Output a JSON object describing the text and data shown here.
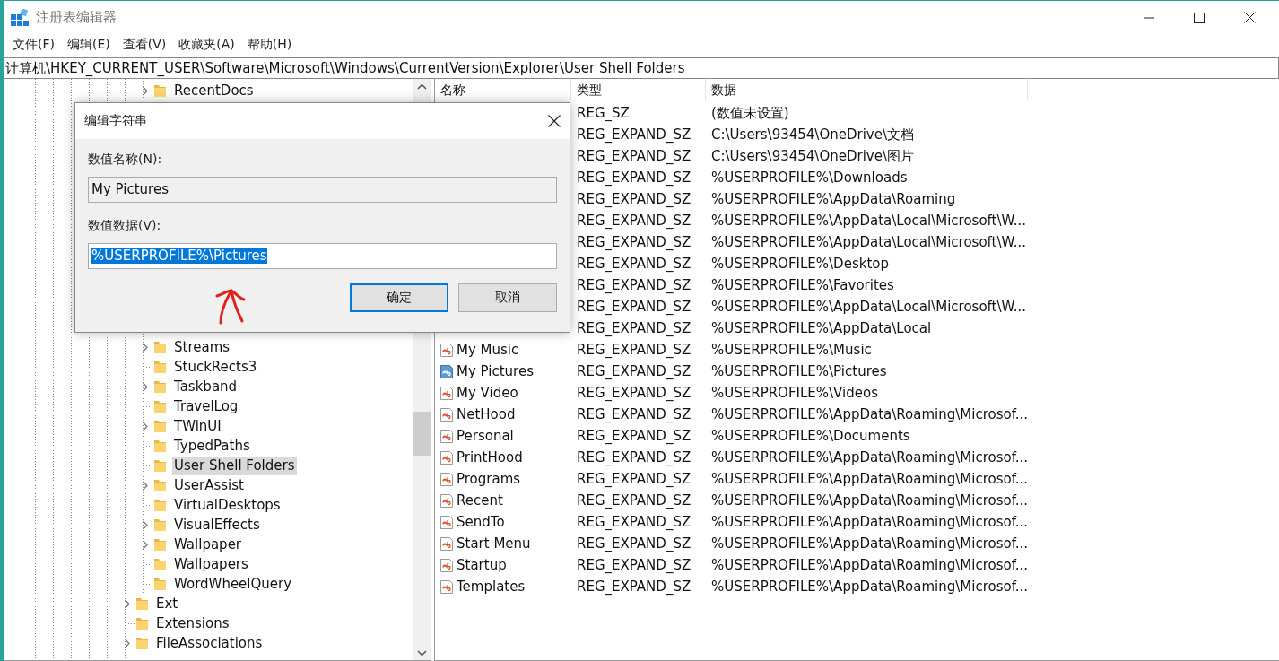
{
  "window": {
    "title": "注册表编辑器"
  },
  "menu": [
    "文件(F)",
    "编辑(E)",
    "查看(V)",
    "收藏夹(A)",
    "帮助(H)"
  ],
  "address": "计算机\\HKEY_CURRENT_USER\\Software\\Microsoft\\Windows\\CurrentVersion\\Explorer\\User Shell Folders",
  "tree": [
    {
      "children": [
        {
          "label": "RecentDocs",
          "expandable": true,
          "selected": false
        },
        {
          "label": "Streams",
          "expandable": true,
          "selected": false
        },
        {
          "label": "StuckRects3",
          "expandable": false,
          "selected": false
        },
        {
          "label": "Taskband",
          "expandable": true,
          "selected": false
        },
        {
          "label": "TravelLog",
          "expandable": false,
          "selected": false
        },
        {
          "label": "TWinUI",
          "expandable": true,
          "selected": false
        },
        {
          "label": "TypedPaths",
          "expandable": false,
          "selected": false
        },
        {
          "label": "User Shell Folders",
          "expandable": false,
          "selected": true
        },
        {
          "label": "UserAssist",
          "expandable": true,
          "selected": false
        },
        {
          "label": "VirtualDesktops",
          "expandable": false,
          "selected": false
        },
        {
          "label": "VisualEffects",
          "expandable": true,
          "selected": false
        },
        {
          "label": "Wallpaper",
          "expandable": true,
          "selected": false
        },
        {
          "label": "Wallpapers",
          "expandable": false,
          "selected": false
        },
        {
          "label": "WordWheelQuery",
          "expandable": false,
          "selected": false
        }
      ]
    },
    {
      "label": "Ext",
      "expandable": true,
      "selected": false
    },
    {
      "label": "Extensions",
      "expandable": false,
      "selected": false
    },
    {
      "label": "FileAssociations",
      "expandable": true,
      "selected": false
    }
  ],
  "table": {
    "columns": [
      "名称",
      "类型",
      "数据"
    ],
    "rows": [
      {
        "type": "REG_SZ",
        "data": "(数值未设置)"
      },
      {
        "type": "REG_EXPAND_SZ",
        "data": "C:\\Users\\93454\\OneDrive\\文档"
      },
      {
        "type": "REG_EXPAND_SZ",
        "data": "C:\\Users\\93454\\OneDrive\\图片"
      },
      {
        "type": "REG_EXPAND_SZ",
        "data": "%USERPROFILE%\\Downloads"
      },
      {
        "type": "REG_EXPAND_SZ",
        "data": "%USERPROFILE%\\AppData\\Roaming"
      },
      {
        "type": "REG_EXPAND_SZ",
        "data": "%USERPROFILE%\\AppData\\Local\\Microsoft\\W..."
      },
      {
        "type": "REG_EXPAND_SZ",
        "data": "%USERPROFILE%\\AppData\\Local\\Microsoft\\W..."
      },
      {
        "type": "REG_EXPAND_SZ",
        "data": "%USERPROFILE%\\Desktop"
      },
      {
        "type": "REG_EXPAND_SZ",
        "data": "%USERPROFILE%\\Favorites"
      },
      {
        "type": "REG_EXPAND_SZ",
        "data": "%USERPROFILE%\\AppData\\Local\\Microsoft\\W..."
      },
      {
        "type": "REG_EXPAND_SZ",
        "data": "%USERPROFILE%\\AppData\\Local"
      },
      {
        "name": "My Music",
        "type": "REG_EXPAND_SZ",
        "data": "%USERPROFILE%\\Music",
        "selected": false
      },
      {
        "name": "My Pictures",
        "type": "REG_EXPAND_SZ",
        "data": "%USERPROFILE%\\Pictures",
        "selected": true
      },
      {
        "name": "My Video",
        "type": "REG_EXPAND_SZ",
        "data": "%USERPROFILE%\\Videos",
        "selected": false
      },
      {
        "name": "NetHood",
        "type": "REG_EXPAND_SZ",
        "data": "%USERPROFILE%\\AppData\\Roaming\\Microsof...",
        "selected": false
      },
      {
        "name": "Personal",
        "type": "REG_EXPAND_SZ",
        "data": "%USERPROFILE%\\Documents",
        "selected": false
      },
      {
        "name": "PrintHood",
        "type": "REG_EXPAND_SZ",
        "data": "%USERPROFILE%\\AppData\\Roaming\\Microsof...",
        "selected": false
      },
      {
        "name": "Programs",
        "type": "REG_EXPAND_SZ",
        "data": "%USERPROFILE%\\AppData\\Roaming\\Microsof...",
        "selected": false
      },
      {
        "name": "Recent",
        "type": "REG_EXPAND_SZ",
        "data": "%USERPROFILE%\\AppData\\Roaming\\Microsof...",
        "selected": false
      },
      {
        "name": "SendTo",
        "type": "REG_EXPAND_SZ",
        "data": "%USERPROFILE%\\AppData\\Roaming\\Microsof...",
        "selected": false
      },
      {
        "name": "Start Menu",
        "type": "REG_EXPAND_SZ",
        "data": "%USERPROFILE%\\AppData\\Roaming\\Microsof...",
        "selected": false
      },
      {
        "name": "Startup",
        "type": "REG_EXPAND_SZ",
        "data": "%USERPROFILE%\\AppData\\Roaming\\Microsof...",
        "selected": false
      },
      {
        "name": "Templates",
        "type": "REG_EXPAND_SZ",
        "data": "%USERPROFILE%\\AppData\\Roaming\\Microsof...",
        "selected": false
      }
    ]
  },
  "dialog": {
    "title": "编辑字符串",
    "name_label": "数值名称(N):",
    "name_value": "My Pictures",
    "data_label": "数值数据(V):",
    "data_value": "%USERPROFILE%\\Pictures",
    "data_value_selected": true,
    "buttons": [
      {
        "label": "确定",
        "default": true
      },
      {
        "label": "取消",
        "default": false
      }
    ]
  }
}
